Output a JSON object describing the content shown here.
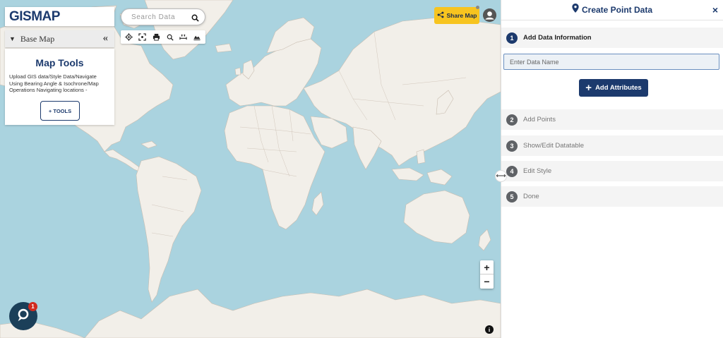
{
  "logo": {
    "text": "GISMAP"
  },
  "basemap": {
    "label": "Base Map",
    "collapse_glyph": "«"
  },
  "tools_card": {
    "title": "Map Tools",
    "description": "Upload GIS data/Style Data/Navigate Using Bearing Angle & Isochrone/Map Operations Navigating locations -",
    "button_label": "+ TOOLS"
  },
  "search": {
    "placeholder": "Search Data"
  },
  "toolbar": {
    "icons": [
      "locate-icon",
      "fullscreen-icon",
      "print-icon",
      "zoom-search-icon",
      "measure-icon",
      "layers-icon"
    ]
  },
  "share": {
    "label": "Share Map"
  },
  "zoom": {
    "in": "+",
    "out": "−"
  },
  "info": {
    "glyph": "i"
  },
  "chat": {
    "badge": "1"
  },
  "panel": {
    "title": "Create Point Data",
    "close": "×",
    "steps": [
      {
        "num": "1",
        "label": "Add Data Information"
      },
      {
        "num": "2",
        "label": "Add Points"
      },
      {
        "num": "3",
        "label": "Show/Edit Datatable"
      },
      {
        "num": "4",
        "label": "Edit Style"
      },
      {
        "num": "5",
        "label": "Done"
      }
    ],
    "data_name_placeholder": "Enter Data Name",
    "add_attributes_label": "Add Attributes"
  },
  "colors": {
    "ocean": "#aad3df",
    "land": "#f2efe9",
    "brand_navy": "#1c3a6d",
    "share_yellow": "#f7c41f",
    "chat_bg": "#1b3f59",
    "badge_red": "#d12a1f"
  }
}
